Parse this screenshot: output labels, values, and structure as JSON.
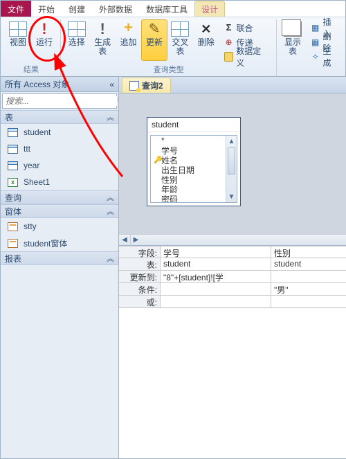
{
  "tabs": {
    "file": "文件",
    "home": "开始",
    "create": "创建",
    "external": "外部数据",
    "dbtools": "数据库工具",
    "design": "设计"
  },
  "ribbon": {
    "view": "视图",
    "run": "运行",
    "select": "选择",
    "maketable": "生成表",
    "append": "追加",
    "update": "更新",
    "crosstab": "交叉表",
    "delete": "删除",
    "union": "联合",
    "passthrough": "传递",
    "datadef": "数据定义",
    "showtable": "显示表",
    "insertrows": "插入",
    "deleterows": "删除",
    "builder": "生成",
    "group_results": "结果",
    "group_querytype": "查询类型"
  },
  "nav": {
    "title": "所有 Access 对象",
    "search_ph": "搜索...",
    "sections": {
      "tables": "表",
      "queries": "查询",
      "forms": "窗体",
      "reports": "报表"
    },
    "tables": [
      "student",
      "ttt",
      "year",
      "Sheet1"
    ],
    "forms": [
      "stty",
      "student窗体"
    ]
  },
  "doc": {
    "tab": "查询2"
  },
  "tablebox": {
    "name": "student",
    "fields": [
      "*",
      "学号",
      "姓名",
      "出生日期",
      "性别",
      "年龄",
      "密码"
    ],
    "key_index": 2
  },
  "design_grid": {
    "rows": [
      "字段:",
      "表:",
      "更新到:",
      "条件:",
      "或:"
    ],
    "cols": [
      {
        "field": "学号",
        "table": "student",
        "updateto": "\"8\"+[student]![学",
        "criteria": "",
        "or": ""
      },
      {
        "field": "性别",
        "table": "student",
        "updateto": "",
        "criteria": "\"男\"",
        "or": ""
      }
    ]
  }
}
